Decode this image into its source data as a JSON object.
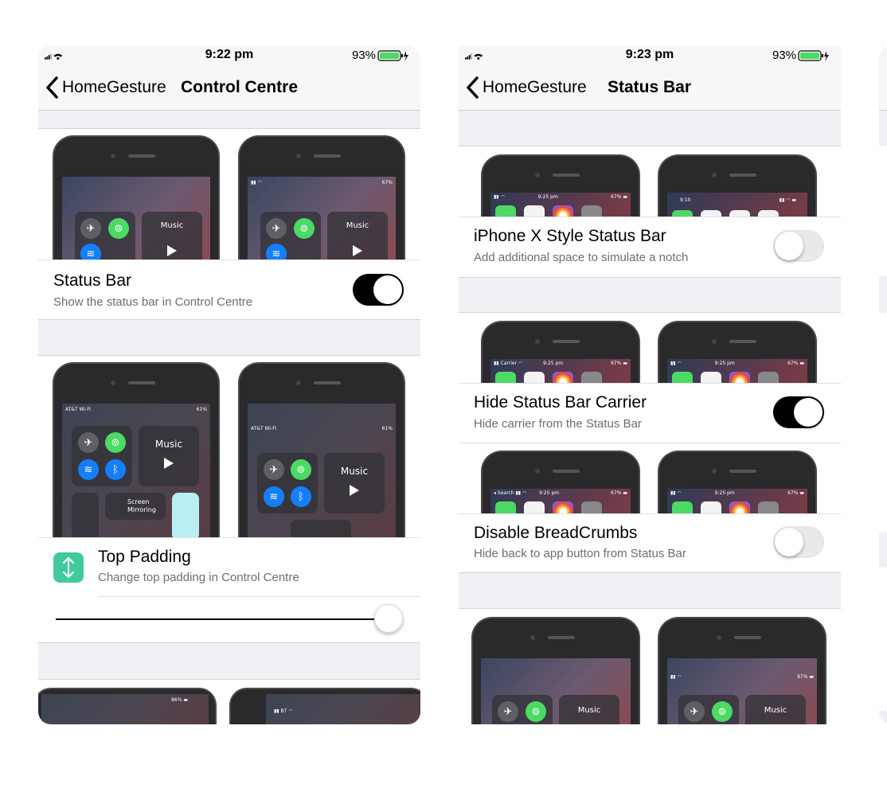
{
  "screens": [
    {
      "status": {
        "time": "9:22 pm",
        "battery": "93%"
      },
      "nav": {
        "back_label": "HomeGesture",
        "title": "Control Centre"
      },
      "rows": [
        {
          "title": "Status Bar",
          "subtitle": "Show the status bar in Control Centre",
          "toggle_on": true
        },
        {
          "title": "Top Padding",
          "subtitle": "Change top padding in Control Centre",
          "slider_value": 1.0
        }
      ],
      "preview_text": {
        "music": "Music",
        "carrier": "AT&T Wi-Fi",
        "battery_small": "61%",
        "screen_mirroring": "Screen Mirroring"
      }
    },
    {
      "status": {
        "time": "9:23 pm",
        "battery": "93%"
      },
      "nav": {
        "back_label": "HomeGesture",
        "title": "Status Bar"
      },
      "rows": [
        {
          "title": "iPhone X Style Status Bar",
          "subtitle": "Add additional space to simulate a notch",
          "toggle_on": false
        },
        {
          "title": "Hide Status Bar Carrier",
          "subtitle": "Hide carrier from the Status Bar",
          "toggle_on": true
        },
        {
          "title": "Disable BreadCrumbs",
          "subtitle": "Hide back to app button from Status Bar",
          "toggle_on": false
        }
      ],
      "preview_text": {
        "music": "Music",
        "time_small": "9:25 pm",
        "time_notch": "9:10"
      }
    }
  ],
  "colors": {
    "toggle_on": "#000000",
    "toggle_off": "#e9e9ea",
    "group_background": "#efeff4",
    "icon_tile": "#3fcc9a"
  }
}
